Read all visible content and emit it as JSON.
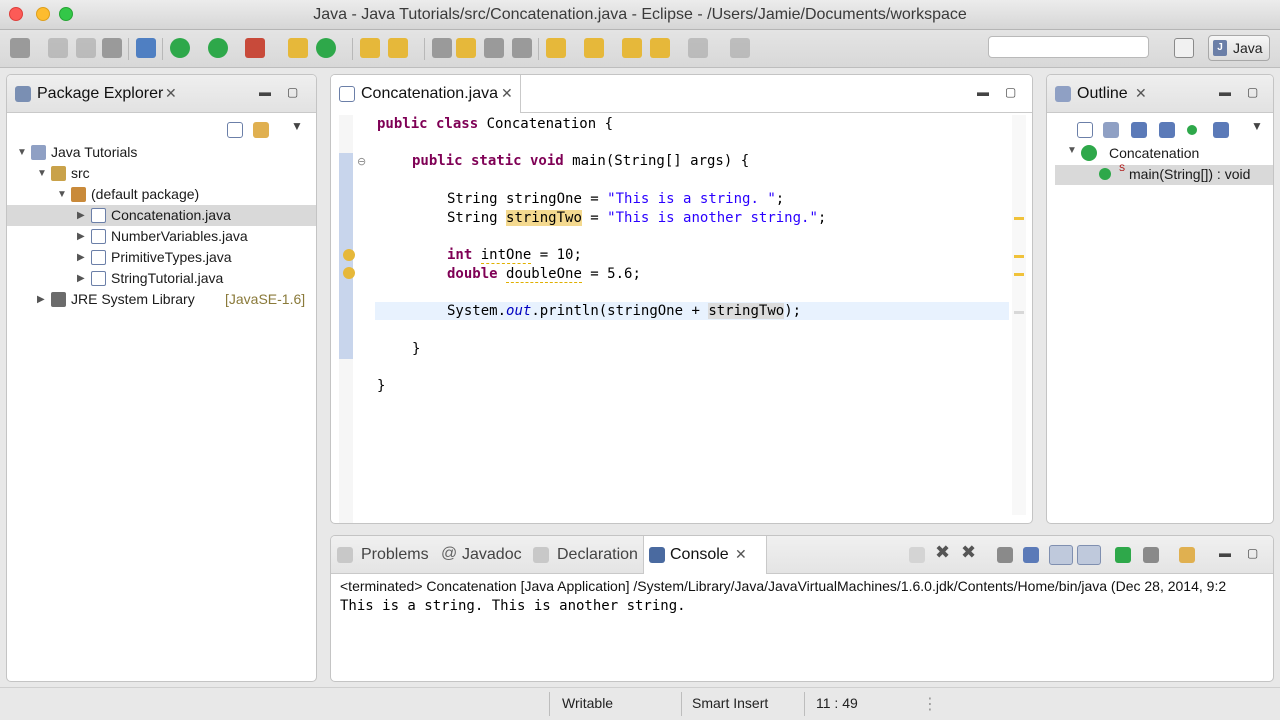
{
  "window": {
    "title": "Java - Java Tutorials/src/Concatenation.java - Eclipse - /Users/Jamie/Documents/workspace"
  },
  "toolbar": {
    "perspective_label": "Java"
  },
  "package_explorer": {
    "title": "Package Explorer",
    "tree": [
      {
        "label": "Java Tutorials",
        "level": 0,
        "expanded": true,
        "icon": "project-icon"
      },
      {
        "label": "src",
        "level": 1,
        "expanded": true,
        "icon": "source-folder-icon"
      },
      {
        "label": "(default package)",
        "level": 2,
        "expanded": true,
        "icon": "package-icon"
      },
      {
        "label": "Concatenation.java",
        "level": 3,
        "expanded": false,
        "icon": "java-file-icon",
        "selected": true
      },
      {
        "label": "NumberVariables.java",
        "level": 3,
        "expanded": false,
        "icon": "java-file-icon"
      },
      {
        "label": "PrimitiveTypes.java",
        "level": 3,
        "expanded": false,
        "icon": "java-file-icon"
      },
      {
        "label": "StringTutorial.java",
        "level": 3,
        "expanded": false,
        "icon": "java-file-icon"
      },
      {
        "label": "JRE System Library",
        "suffix": "[JavaSE-1.6]",
        "level": 1,
        "expanded": false,
        "icon": "library-icon"
      }
    ]
  },
  "editor": {
    "tab_label": "Concatenation.java",
    "code": {
      "l1_kw": "public class",
      "l1_rest": " Concatenation {",
      "l2_kw": "public static void",
      "l2_rest": " main(String[] args) {",
      "l3_type": "String ",
      "l3_var": "stringOne",
      "l3_eq": " = ",
      "l3_str": "\"This is a string. \"",
      "l3_end": ";",
      "l4_type": "String ",
      "l4_var": "stringTwo",
      "l4_eq": " = ",
      "l4_str": "\"This is another string.\"",
      "l4_end": ";",
      "l5_kw": "int",
      "l5_sp": " ",
      "l5_var": "intOne",
      "l5_rest": " = 10;",
      "l6_kw": "double",
      "l6_sp": " ",
      "l6_var": "doubleOne",
      "l6_rest": " = 5.6;",
      "l7_a": "System.",
      "l7_field": "out",
      "l7_b": ".println(stringOne + ",
      "l7_var": "stringTwo",
      "l7_c": ");",
      "l8": "}",
      "l9": "}"
    }
  },
  "outline": {
    "title": "Outline",
    "class_label": "Concatenation",
    "method_label": "main(String[]) : void",
    "method_modifier": "S"
  },
  "console_view": {
    "tabs": [
      {
        "label": "Problems",
        "active": false
      },
      {
        "label": "Javadoc",
        "active": false
      },
      {
        "label": "Declaration",
        "active": false
      },
      {
        "label": "Console",
        "active": true
      }
    ],
    "header": "<terminated> Concatenation [Java Application] /System/Library/Java/JavaVirtualMachines/1.6.0.jdk/Contents/Home/bin/java (Dec 28, 2014, 9:2",
    "output": "This is a string. This is another string."
  },
  "statusbar": {
    "mode": "Writable",
    "insert": "Smart Insert",
    "position": "11 : 49"
  },
  "colors": {
    "keyword": "#7f0055",
    "string": "#2a00ff",
    "highlight": "#f4d98f",
    "selection": "#d9d9d9"
  }
}
